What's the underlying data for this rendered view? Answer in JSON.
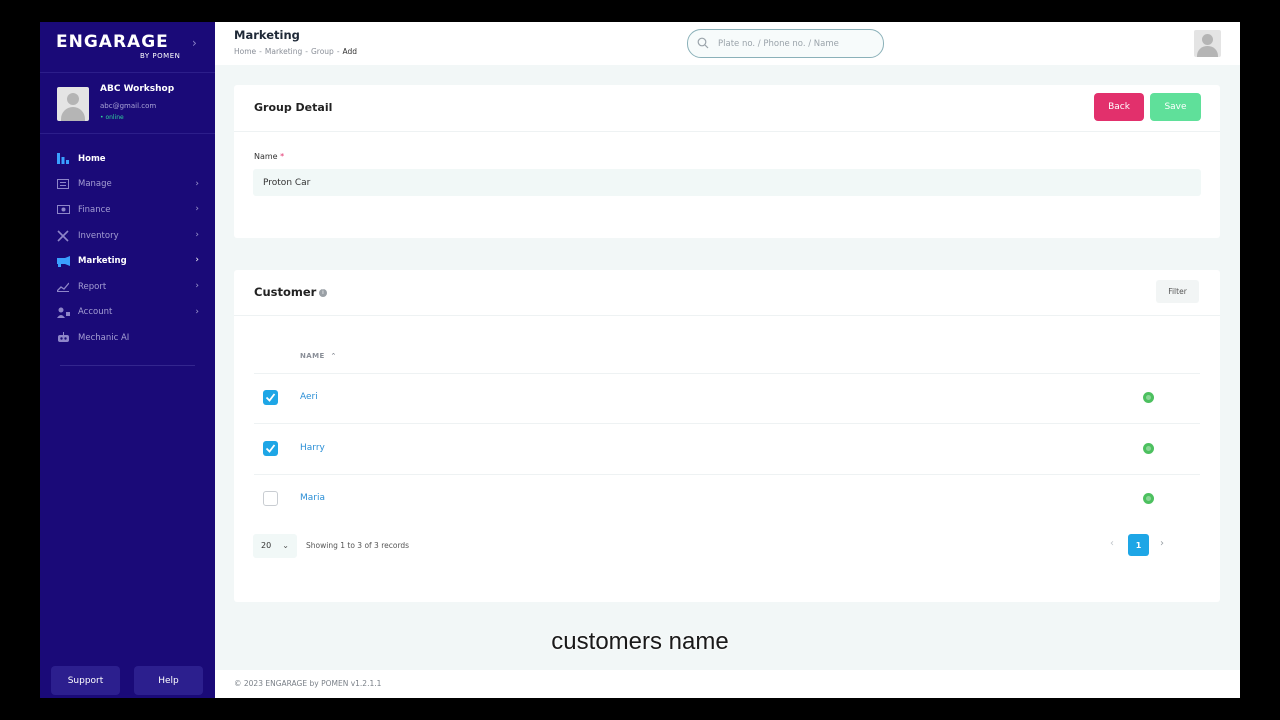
{
  "brand": {
    "logo": "ENGARAGE",
    "logo_sub": "BY POMEN"
  },
  "profile": {
    "name": "ABC Workshop",
    "email": "abc@gmail.com",
    "status": "• online"
  },
  "nav": [
    {
      "label": "Home",
      "icon": "home-icon",
      "active": true,
      "chevron": false
    },
    {
      "label": "Manage",
      "icon": "manage-icon",
      "active": false,
      "chevron": true
    },
    {
      "label": "Finance",
      "icon": "finance-icon",
      "active": false,
      "chevron": true
    },
    {
      "label": "Inventory",
      "icon": "inventory-icon",
      "active": false,
      "chevron": true
    },
    {
      "label": "Marketing",
      "icon": "marketing-icon",
      "active": true,
      "chevron": true
    },
    {
      "label": "Report",
      "icon": "report-icon",
      "active": false,
      "chevron": true
    },
    {
      "label": "Account",
      "icon": "account-icon",
      "active": false,
      "chevron": true
    },
    {
      "label": "Mechanic AI",
      "icon": "robot-icon",
      "active": false,
      "chevron": false
    }
  ],
  "sidebar_buttons": {
    "support": "Support",
    "help": "Help"
  },
  "header": {
    "title": "Marketing",
    "breadcrumb": [
      "Home",
      "Marketing",
      "Group",
      "Add"
    ],
    "search_placeholder": "Plate no. / Phone no. / Name"
  },
  "group_detail": {
    "title": "Group Detail",
    "back_label": "Back",
    "save_label": "Save",
    "name_label": "Name",
    "required_mark": "*",
    "name_value": "Proton Car"
  },
  "customer": {
    "title": "Customer",
    "filter_label": "Filter",
    "column_header": "NAME",
    "rows": [
      {
        "name": "Aeri",
        "checked": true
      },
      {
        "name": "Harry",
        "checked": true
      },
      {
        "name": "Maria",
        "checked": false
      }
    ],
    "page_size": "20",
    "showing_text": "Showing 1 to 3 of 3 records",
    "current_page": "1"
  },
  "footer": {
    "copyright": "© 2023  ENGARAGE by POMEN v1.2.1.1"
  },
  "caption": "customers name",
  "colors": {
    "sidebar": "#1a0a78",
    "back_button": "#e2306c",
    "save_button": "#5fe09a",
    "accent": "#1ea6e6",
    "link": "#2b8fd6"
  }
}
